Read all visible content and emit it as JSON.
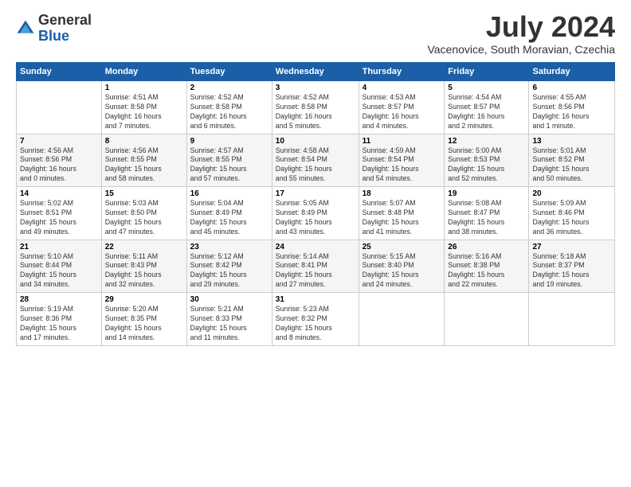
{
  "logo": {
    "general": "General",
    "blue": "Blue"
  },
  "title": "July 2024",
  "location": "Vacenovice, South Moravian, Czechia",
  "days_of_week": [
    "Sunday",
    "Monday",
    "Tuesday",
    "Wednesday",
    "Thursday",
    "Friday",
    "Saturday"
  ],
  "weeks": [
    [
      {
        "day": "",
        "info": ""
      },
      {
        "day": "1",
        "info": "Sunrise: 4:51 AM\nSunset: 8:58 PM\nDaylight: 16 hours\nand 7 minutes."
      },
      {
        "day": "2",
        "info": "Sunrise: 4:52 AM\nSunset: 8:58 PM\nDaylight: 16 hours\nand 6 minutes."
      },
      {
        "day": "3",
        "info": "Sunrise: 4:52 AM\nSunset: 8:58 PM\nDaylight: 16 hours\nand 5 minutes."
      },
      {
        "day": "4",
        "info": "Sunrise: 4:53 AM\nSunset: 8:57 PM\nDaylight: 16 hours\nand 4 minutes."
      },
      {
        "day": "5",
        "info": "Sunrise: 4:54 AM\nSunset: 8:57 PM\nDaylight: 16 hours\nand 2 minutes."
      },
      {
        "day": "6",
        "info": "Sunrise: 4:55 AM\nSunset: 8:56 PM\nDaylight: 16 hours\nand 1 minute."
      }
    ],
    [
      {
        "day": "7",
        "info": "Sunrise: 4:56 AM\nSunset: 8:56 PM\nDaylight: 16 hours\nand 0 minutes."
      },
      {
        "day": "8",
        "info": "Sunrise: 4:56 AM\nSunset: 8:55 PM\nDaylight: 15 hours\nand 58 minutes."
      },
      {
        "day": "9",
        "info": "Sunrise: 4:57 AM\nSunset: 8:55 PM\nDaylight: 15 hours\nand 57 minutes."
      },
      {
        "day": "10",
        "info": "Sunrise: 4:58 AM\nSunset: 8:54 PM\nDaylight: 15 hours\nand 55 minutes."
      },
      {
        "day": "11",
        "info": "Sunrise: 4:59 AM\nSunset: 8:54 PM\nDaylight: 15 hours\nand 54 minutes."
      },
      {
        "day": "12",
        "info": "Sunrise: 5:00 AM\nSunset: 8:53 PM\nDaylight: 15 hours\nand 52 minutes."
      },
      {
        "day": "13",
        "info": "Sunrise: 5:01 AM\nSunset: 8:52 PM\nDaylight: 15 hours\nand 50 minutes."
      }
    ],
    [
      {
        "day": "14",
        "info": "Sunrise: 5:02 AM\nSunset: 8:51 PM\nDaylight: 15 hours\nand 49 minutes."
      },
      {
        "day": "15",
        "info": "Sunrise: 5:03 AM\nSunset: 8:50 PM\nDaylight: 15 hours\nand 47 minutes."
      },
      {
        "day": "16",
        "info": "Sunrise: 5:04 AM\nSunset: 8:49 PM\nDaylight: 15 hours\nand 45 minutes."
      },
      {
        "day": "17",
        "info": "Sunrise: 5:05 AM\nSunset: 8:49 PM\nDaylight: 15 hours\nand 43 minutes."
      },
      {
        "day": "18",
        "info": "Sunrise: 5:07 AM\nSunset: 8:48 PM\nDaylight: 15 hours\nand 41 minutes."
      },
      {
        "day": "19",
        "info": "Sunrise: 5:08 AM\nSunset: 8:47 PM\nDaylight: 15 hours\nand 38 minutes."
      },
      {
        "day": "20",
        "info": "Sunrise: 5:09 AM\nSunset: 8:46 PM\nDaylight: 15 hours\nand 36 minutes."
      }
    ],
    [
      {
        "day": "21",
        "info": "Sunrise: 5:10 AM\nSunset: 8:44 PM\nDaylight: 15 hours\nand 34 minutes."
      },
      {
        "day": "22",
        "info": "Sunrise: 5:11 AM\nSunset: 8:43 PM\nDaylight: 15 hours\nand 32 minutes."
      },
      {
        "day": "23",
        "info": "Sunrise: 5:12 AM\nSunset: 8:42 PM\nDaylight: 15 hours\nand 29 minutes."
      },
      {
        "day": "24",
        "info": "Sunrise: 5:14 AM\nSunset: 8:41 PM\nDaylight: 15 hours\nand 27 minutes."
      },
      {
        "day": "25",
        "info": "Sunrise: 5:15 AM\nSunset: 8:40 PM\nDaylight: 15 hours\nand 24 minutes."
      },
      {
        "day": "26",
        "info": "Sunrise: 5:16 AM\nSunset: 8:38 PM\nDaylight: 15 hours\nand 22 minutes."
      },
      {
        "day": "27",
        "info": "Sunrise: 5:18 AM\nSunset: 8:37 PM\nDaylight: 15 hours\nand 19 minutes."
      }
    ],
    [
      {
        "day": "28",
        "info": "Sunrise: 5:19 AM\nSunset: 8:36 PM\nDaylight: 15 hours\nand 17 minutes."
      },
      {
        "day": "29",
        "info": "Sunrise: 5:20 AM\nSunset: 8:35 PM\nDaylight: 15 hours\nand 14 minutes."
      },
      {
        "day": "30",
        "info": "Sunrise: 5:21 AM\nSunset: 8:33 PM\nDaylight: 15 hours\nand 11 minutes."
      },
      {
        "day": "31",
        "info": "Sunrise: 5:23 AM\nSunset: 8:32 PM\nDaylight: 15 hours\nand 8 minutes."
      },
      {
        "day": "",
        "info": ""
      },
      {
        "day": "",
        "info": ""
      },
      {
        "day": "",
        "info": ""
      }
    ]
  ]
}
